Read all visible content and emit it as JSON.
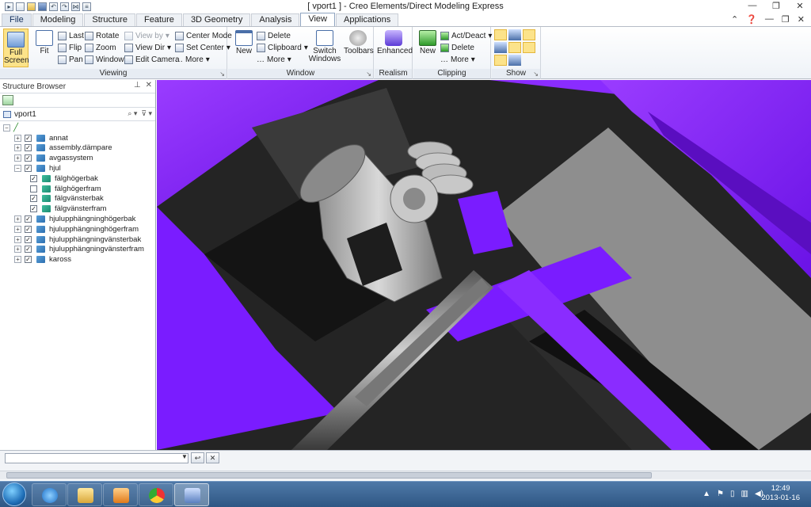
{
  "window": {
    "title": "[ vport1 ] - Creo Elements/Direct Modeling Express"
  },
  "tabs": [
    {
      "label": "File"
    },
    {
      "label": "Modeling"
    },
    {
      "label": "Structure"
    },
    {
      "label": "Feature"
    },
    {
      "label": "3D Geometry"
    },
    {
      "label": "Analysis"
    },
    {
      "label": "View"
    },
    {
      "label": "Applications"
    }
  ],
  "ribbon": {
    "viewing": {
      "label": "Viewing",
      "full_screen": "Full Screen",
      "fit": "Fit",
      "last": "Last",
      "flip": "Flip",
      "pan": "Pan",
      "rotate": "Rotate",
      "zoom": "Zoom",
      "window": "Window",
      "view_by": "View by",
      "view_dir": "View Dir",
      "edit_camera": "Edit Camera",
      "center_mode": "Center Mode",
      "set_center": "Set Center",
      "more": "More"
    },
    "window": {
      "label": "Window",
      "new": "New",
      "delete": "Delete",
      "clipboard": "Clipboard",
      "more": "More",
      "switch_windows": "Switch Windows",
      "toolbars": "Toolbars"
    },
    "realism": {
      "label": "Realism",
      "enhanced": "Enhanced"
    },
    "clipping": {
      "label": "Clipping",
      "new": "New",
      "act_deact": "Act/Deact",
      "delete": "Delete",
      "more": "More"
    },
    "show": {
      "label": "Show"
    }
  },
  "browser": {
    "title": "Structure Browser",
    "viewport": "vport1",
    "items": [
      {
        "label": "annat",
        "type": "asm",
        "level": 1,
        "checked": true,
        "expander": "+"
      },
      {
        "label": "assembly.dämpare",
        "type": "asm",
        "level": 1,
        "checked": true,
        "expander": "+"
      },
      {
        "label": "avgassystem",
        "type": "asm",
        "level": 1,
        "checked": true,
        "expander": "+"
      },
      {
        "label": "hjul",
        "type": "asm",
        "level": 1,
        "checked": true,
        "expander": "-"
      },
      {
        "label": "fälghögerbak",
        "type": "part",
        "level": 2,
        "checked": true,
        "expander": ""
      },
      {
        "label": "fälghögerfram",
        "type": "part",
        "level": 2,
        "checked": false,
        "expander": ""
      },
      {
        "label": "fälgvänsterbak",
        "type": "part",
        "level": 2,
        "checked": true,
        "expander": ""
      },
      {
        "label": "fälgvänsterfram",
        "type": "part",
        "level": 2,
        "checked": true,
        "expander": ""
      },
      {
        "label": "hjulupphängninghögerbak",
        "type": "asm",
        "level": 1,
        "checked": true,
        "expander": "+"
      },
      {
        "label": "hjulupphängninghögerfram",
        "type": "asm",
        "level": 1,
        "checked": true,
        "expander": "+"
      },
      {
        "label": "hjulupphängningvänsterbak",
        "type": "asm",
        "level": 1,
        "checked": true,
        "expander": "+"
      },
      {
        "label": "hjulupphängningvänsterfram",
        "type": "asm",
        "level": 1,
        "checked": true,
        "expander": "+"
      },
      {
        "label": "kaross",
        "type": "asm",
        "level": 1,
        "checked": true,
        "expander": "+"
      }
    ]
  },
  "taskbar": {
    "time": "12:49",
    "date": "2013-01-16"
  },
  "colors": {
    "accent_purple": "#7a1cff",
    "ribbon_highlight": "#fce38a"
  }
}
